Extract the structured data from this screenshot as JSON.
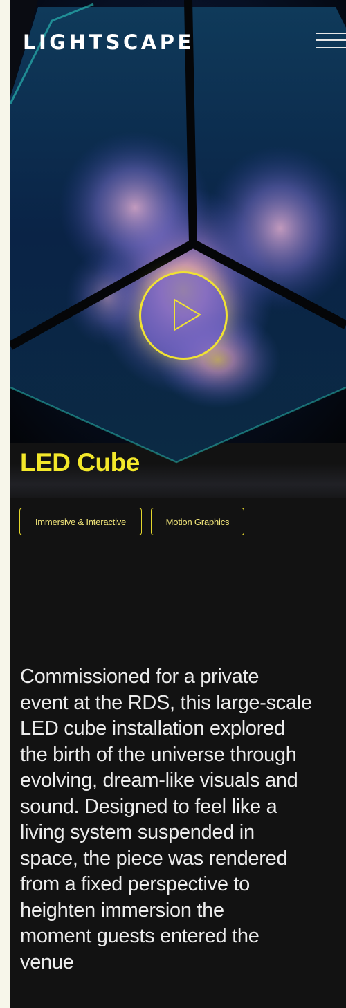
{
  "header": {
    "logo": "LIGHTSCAPE",
    "menu_icon": "hamburger-menu-icon"
  },
  "hero": {
    "play_icon": "play-icon",
    "accent_color": "#f0e233"
  },
  "project": {
    "title": "LED Cube",
    "tags": [
      "Immersive & Interactive",
      "Motion Graphics"
    ],
    "description_lines": [
      "Commissioned for a private",
      "event at the RDS, this large-scale",
      "LED cube installation explored",
      "the birth of the universe through",
      "evolving, dream-like visuals and",
      "sound. Designed to feel like a",
      "living system suspended in",
      "space, the piece was rendered",
      "from a fixed perspective to",
      "heighten immersion the",
      "moment guests entered the",
      "venue"
    ]
  },
  "colors": {
    "background": "#121212",
    "title": "#f3e82a",
    "tag_border": "#e3d62c",
    "text": "#ececec"
  }
}
